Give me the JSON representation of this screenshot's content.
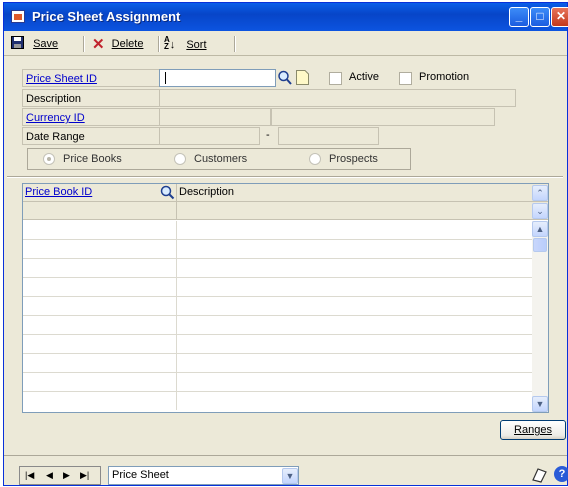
{
  "window": {
    "title": "Price Sheet Assignment"
  },
  "toolbar": {
    "save": "Save",
    "delete": "Delete",
    "sort": "Sort"
  },
  "form": {
    "price_sheet_id_label": "Price Sheet ID",
    "price_sheet_id_value": "",
    "active_label": "Active",
    "promotion_label": "Promotion",
    "description_label": "Description",
    "currency_id_label": "Currency ID",
    "date_range_label": "Date Range",
    "date_range_separator": "-",
    "assign_options": [
      "Price Books",
      "Customers",
      "Prospects"
    ]
  },
  "grid": {
    "columns": [
      "Price Book ID",
      "Description"
    ],
    "rows": [
      "",
      "",
      "",
      "",
      "",
      "",
      "",
      "",
      "",
      "",
      ""
    ]
  },
  "buttons": {
    "ranges": "Ranges"
  },
  "status": {
    "browse_by": "Price Sheet"
  },
  "colors": {
    "title_bar": "#0A5FE8",
    "window_bg": "#ECE9D8",
    "link": "#0000CC"
  }
}
